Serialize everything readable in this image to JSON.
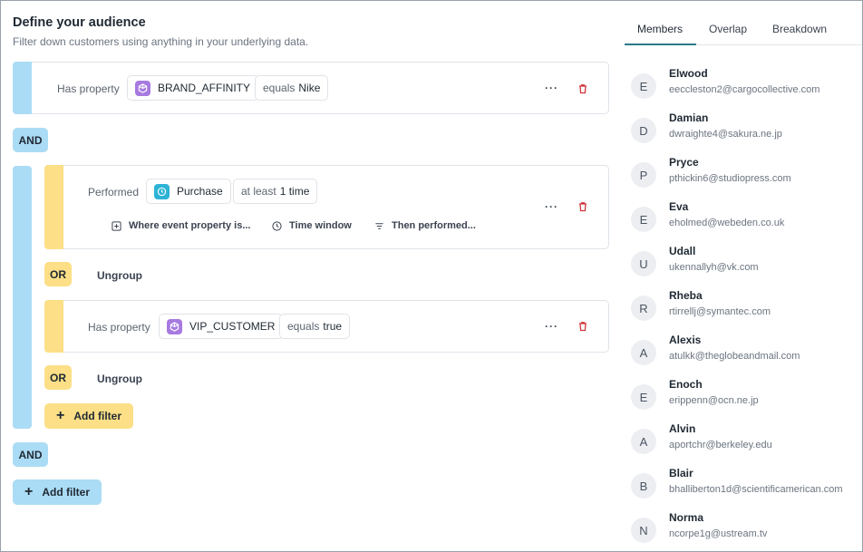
{
  "header": {
    "title": "Define your audience",
    "subtitle": "Filter down customers using anything in your underlying data."
  },
  "filters": {
    "filter1": {
      "label": "Has property",
      "property": "BRAND_AFFINITY",
      "operator": "equals",
      "value": "Nike",
      "more": "···"
    },
    "and1": "AND",
    "group": {
      "event": {
        "label": "Performed",
        "event_name": "Purchase",
        "freq_prefix": "at least",
        "freq_value": "1 time",
        "more": "···"
      },
      "actions": [
        {
          "label": "Where event property is..."
        },
        {
          "label": "Time window"
        },
        {
          "label": "Then performed..."
        }
      ],
      "or1": "OR",
      "ungroup1": "Ungroup",
      "vip": {
        "label": "Has property",
        "property": "VIP_CUSTOMER",
        "operator": "equals",
        "value": "true",
        "more": "···"
      },
      "or2": "OR",
      "ungroup2": "Ungroup",
      "add_filter": "Add filter"
    },
    "and2": "AND",
    "add_filter": "Add filter"
  },
  "tabs": [
    {
      "label": "Members",
      "active": true
    },
    {
      "label": "Overlap",
      "active": false
    },
    {
      "label": "Breakdown",
      "active": false
    }
  ],
  "members": [
    {
      "initial": "E",
      "name": "Elwood",
      "email": "eeccleston2@cargocollective.com"
    },
    {
      "initial": "D",
      "name": "Damian",
      "email": "dwraighte4@sakura.ne.jp"
    },
    {
      "initial": "P",
      "name": "Pryce",
      "email": "pthickin6@studiopress.com"
    },
    {
      "initial": "E",
      "name": "Eva",
      "email": "eholmed@webeden.co.uk"
    },
    {
      "initial": "U",
      "name": "Udall",
      "email": "ukennallyh@vk.com"
    },
    {
      "initial": "R",
      "name": "Rheba",
      "email": "rtirrellj@symantec.com"
    },
    {
      "initial": "A",
      "name": "Alexis",
      "email": "atulkk@theglobeandmail.com"
    },
    {
      "initial": "E",
      "name": "Enoch",
      "email": "erippenn@ocn.ne.jp"
    },
    {
      "initial": "A",
      "name": "Alvin",
      "email": "aportchr@berkeley.edu"
    },
    {
      "initial": "B",
      "name": "Blair",
      "email": "bhalliberton1d@scientificamerican.com"
    },
    {
      "initial": "N",
      "name": "Norma",
      "email": "ncorpe1g@ustream.tv"
    }
  ],
  "colors": {
    "accent_blue": "#abdcf5",
    "accent_yellow": "#fcdf86",
    "property_icon": "#a77ae0",
    "event_icon": "#2eb3d6",
    "delete_icon": "#d0343b",
    "active_tab": "#2c7a8a"
  }
}
